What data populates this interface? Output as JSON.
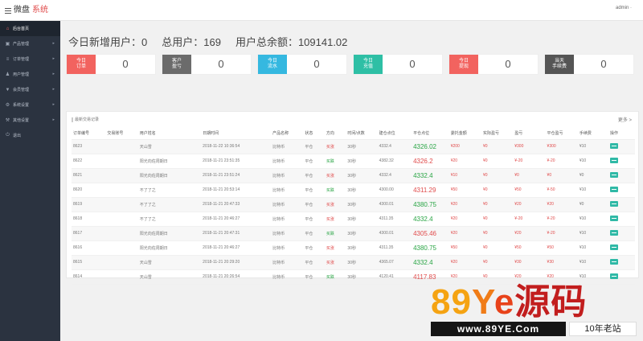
{
  "header": {
    "logo_main": "微盘",
    "logo_accent": "系统",
    "user": "admin ·"
  },
  "sidebar": {
    "items": [
      {
        "label": "后台首页",
        "icon": "home-icon",
        "glyph": "⌂"
      },
      {
        "label": "产品管理",
        "icon": "box-icon",
        "glyph": "▣"
      },
      {
        "label": "订单管理",
        "icon": "list-icon",
        "glyph": "≡"
      },
      {
        "label": "用户管理",
        "icon": "user-icon",
        "glyph": "♟"
      },
      {
        "label": "会员管理",
        "icon": "filter-icon",
        "glyph": "▼"
      },
      {
        "label": "系统设置",
        "icon": "gear-icon",
        "glyph": "⚙"
      },
      {
        "label": "其他设置",
        "icon": "tool-icon",
        "glyph": "⚒"
      },
      {
        "label": "退出",
        "icon": "logout-icon",
        "glyph": "⏻"
      }
    ]
  },
  "stats": {
    "new_users": "今日新增用户：0",
    "total_users": "总用户：169",
    "total_balance": "用户总余额：109141.02"
  },
  "cards": [
    {
      "line1": "今日",
      "line2": "订单",
      "value": "0",
      "color": "#f2635f"
    },
    {
      "line1": "客户",
      "line2": "盈亏",
      "value": "0",
      "color": "#6b6b6b"
    },
    {
      "line1": "今日",
      "line2": "流水",
      "value": "0",
      "color": "#35b8e0"
    },
    {
      "line1": "今日",
      "line2": "充值",
      "value": "0",
      "color": "#2ebfa5"
    },
    {
      "line1": "今日",
      "line2": "提现",
      "value": "0",
      "color": "#f2635f"
    },
    {
      "line1": "当天",
      "line2": "手续费",
      "value": "0",
      "color": "#555555"
    }
  ],
  "panel": {
    "title": "最新交易记录",
    "more": "更多 >"
  },
  "table": {
    "headers": [
      "订单编号",
      "交易账号",
      "用户姓名",
      "日期时间",
      "产品名称",
      "状态",
      "方向",
      "时间/点数",
      "建仓点位",
      "平仓点位",
      "委托金额",
      "实际盈亏",
      "盈亏",
      "平仓盈亏",
      "手续费",
      "操作"
    ],
    "rows": [
      [
        "8623",
        "",
        "天山雪",
        "2018-11-22 10:36:54",
        "比特币",
        "平仓",
        "买涨",
        "30秒",
        "4332.4",
        "4326.02",
        "¥200",
        "¥0",
        "¥300",
        "¥300",
        "¥10",
        ""
      ],
      [
        "8622",
        "",
        "阳光向佐周期日",
        "2018-11-21 23:51:35",
        "比特币",
        "平仓",
        "买跌",
        "30秒",
        "4382.32",
        "4326.2",
        "¥20",
        "¥0",
        "¥-20",
        "¥-20",
        "¥10",
        ""
      ],
      [
        "8621",
        "",
        "阳光向佐周期日",
        "2018-11-21 23:51:24",
        "比特币",
        "平仓",
        "买涨",
        "30秒",
        "4332.4",
        "4332.4",
        "¥10",
        "¥0",
        "¥0",
        "¥0",
        "¥0",
        ""
      ],
      [
        "8620",
        "",
        "不了了之",
        "2018-11-21 20:53:14",
        "比特币",
        "平仓",
        "买跌",
        "30秒",
        "4300.00",
        "4311.29",
        "¥50",
        "¥0",
        "¥50",
        "¥-50",
        "¥10",
        ""
      ],
      [
        "8619",
        "",
        "不了了之",
        "2018-11-21 20:47:33",
        "比特币",
        "平仓",
        "买涨",
        "30秒",
        "4300.01",
        "4380.75",
        "¥20",
        "¥0",
        "¥20",
        "¥20",
        "¥0",
        ""
      ],
      [
        "8618",
        "",
        "不了了之",
        "2018-11-21 20:46:27",
        "比特币",
        "平仓",
        "买涨",
        "30秒",
        "4311.35",
        "4332.4",
        "¥20",
        "¥0",
        "¥-20",
        "¥-20",
        "¥10",
        ""
      ],
      [
        "8617",
        "",
        "阳光向佐周期日",
        "2018-11-21 20:47:31",
        "比特币",
        "平仓",
        "买跌",
        "30秒",
        "4300.01",
        "4305.46",
        "¥20",
        "¥0",
        "¥20",
        "¥-20",
        "¥10",
        ""
      ],
      [
        "8616",
        "",
        "阳光向佐周期日",
        "2018-11-21 20:46:27",
        "比特币",
        "平仓",
        "买涨",
        "30秒",
        "4311.35",
        "4380.75",
        "¥50",
        "¥0",
        "¥50",
        "¥50",
        "¥10",
        ""
      ],
      [
        "8615",
        "",
        "天山雪",
        "2018-11-21 20:29:20",
        "比特币",
        "平仓",
        "买涨",
        "30秒",
        "4365.07",
        "4332.4",
        "¥20",
        "¥0",
        "¥30",
        "¥30",
        "¥10",
        ""
      ],
      [
        "8614",
        "",
        "天山雪",
        "2018-11-21 20:26:54",
        "比特币",
        "平仓",
        "买跌",
        "30秒",
        "4120.41",
        "4117.83",
        "¥20",
        "¥0",
        "¥20",
        "¥20",
        "¥10",
        ""
      ]
    ]
  },
  "watermark": {
    "c1": "89",
    "c2": "Y",
    "c3": "e",
    "c4": "源码",
    "url": "www.89YE.Com",
    "tag": "10年老站"
  }
}
